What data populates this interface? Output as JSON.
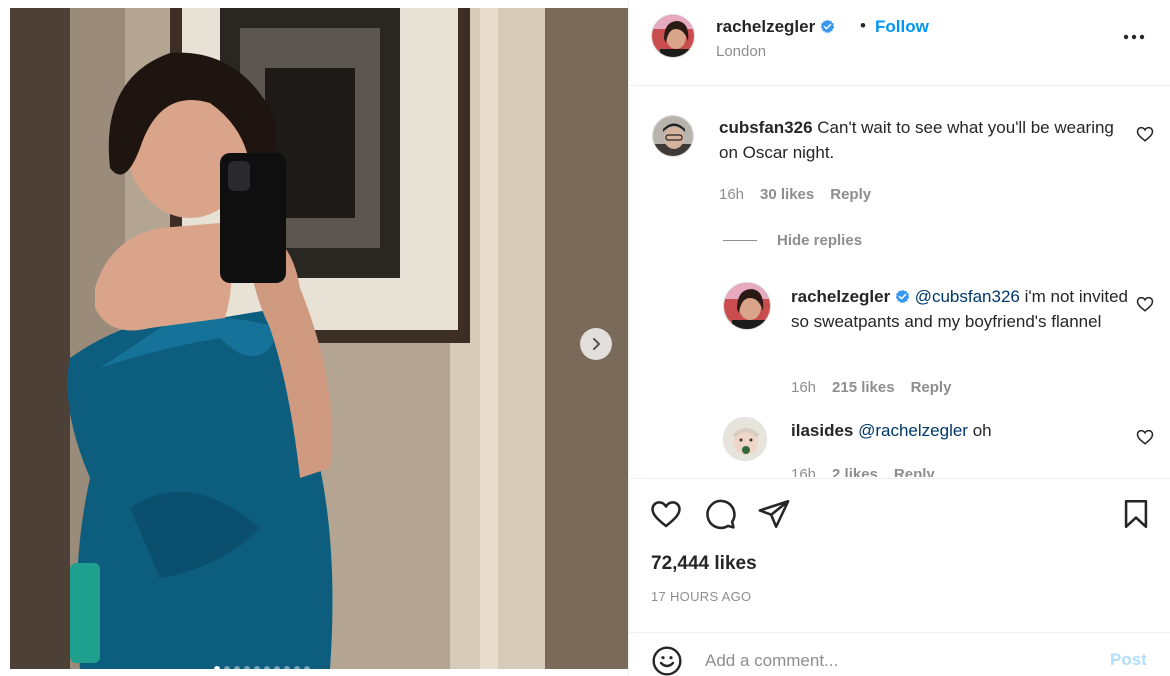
{
  "post": {
    "username": "rachelzegler",
    "location": "London",
    "follow_label": "Follow",
    "separator": "•",
    "carousel": {
      "total_slides": 10,
      "active_slide": 1
    }
  },
  "comments": [
    {
      "username": "cubsfan326",
      "text": "Can't wait to see what you'll be wearing on Oscar night.",
      "time": "16h",
      "likes": "30 likes",
      "reply_label": "Reply"
    }
  ],
  "hide_replies_label": "Hide replies",
  "replies": [
    {
      "username": "rachelzegler",
      "mention": "@cubsfan326",
      "text": "i'm not invited so sweatpants and my boyfriend's flannel",
      "time": "16h",
      "likes": "215 likes",
      "reply_label": "Reply"
    },
    {
      "username": "ilasides",
      "mention": "@rachelzegler",
      "text": "oh",
      "time": "16h",
      "likes": "2 likes",
      "reply_label": "Reply"
    }
  ],
  "likes_count": "72,444 likes",
  "posted_ago": "17 HOURS AGO",
  "add_comment": {
    "placeholder": "Add a comment...",
    "post_label": "Post"
  },
  "icons": {
    "verified": "verified-badge-icon",
    "more": "more-options-icon",
    "like": "heart-icon",
    "comment": "comment-icon",
    "share": "share-icon",
    "save": "bookmark-icon",
    "emoji": "emoji-icon",
    "next": "chevron-right-icon"
  },
  "colors": {
    "link": "#0095f6",
    "verified": "#3897f0",
    "muted": "#8e8e8e",
    "post_disabled": "#b2dffc"
  }
}
